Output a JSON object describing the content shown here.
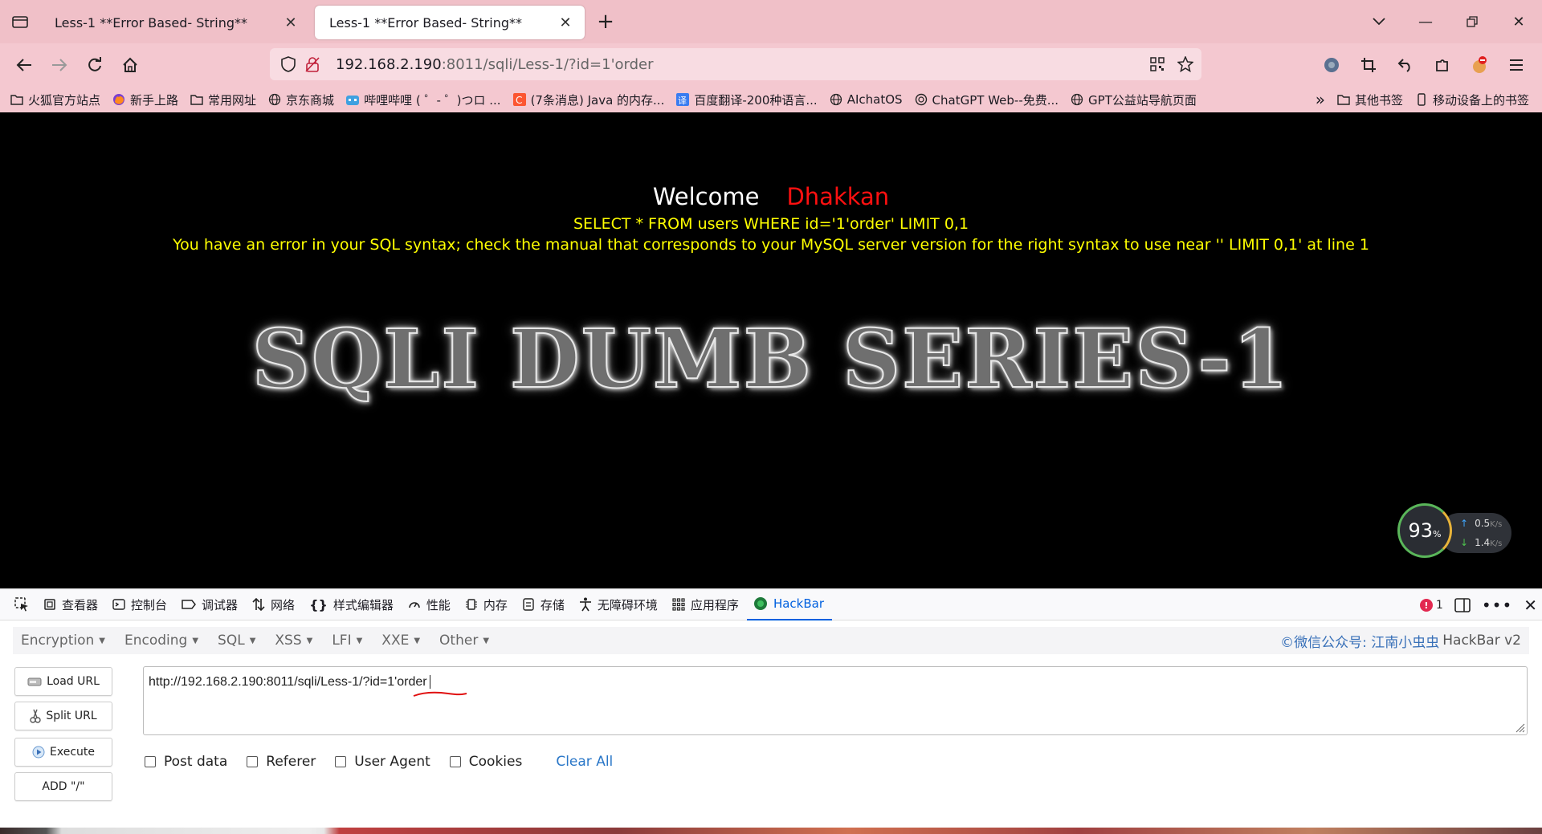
{
  "browser": {
    "tabs": [
      {
        "title": "Less-1 **Error Based- String**",
        "active": false
      },
      {
        "title": "Less-1 **Error Based- String**",
        "active": true
      }
    ],
    "url": {
      "host": "192.168.2.190",
      "rest": ":8011/sqli/Less-1/?id=1'order"
    },
    "bookmarks": [
      {
        "label": "火狐官方站点",
        "icon": "folder-icon"
      },
      {
        "label": "新手上路",
        "icon": "firefox-icon"
      },
      {
        "label": "常用网址",
        "icon": "folder-icon"
      },
      {
        "label": "京东商城",
        "icon": "globe-icon"
      },
      {
        "label": "哔哩哔哩 ( ゜- ゜)つロ ...",
        "icon": "bilibili-icon"
      },
      {
        "label": "(7条消息) Java 的内存...",
        "icon": "csdn-icon"
      },
      {
        "label": "百度翻译-200种语言...",
        "icon": "baidu-translate-icon"
      },
      {
        "label": "AIchatOS",
        "icon": "globe-icon"
      },
      {
        "label": "ChatGPT Web--免费...",
        "icon": "openai-icon"
      },
      {
        "label": "GPT公益站导航页面",
        "icon": "globe-icon"
      }
    ],
    "bookmarks_right": [
      "其他书签",
      "移动设备上的书签"
    ]
  },
  "page": {
    "welcome": "Welcome",
    "name": "Dhakkan",
    "sql": "SELECT * FROM users WHERE id='1'order' LIMIT 0,1",
    "error": "You have an error in your SQL syntax; check the manual that corresponds to your MySQL server version for the right syntax to use near '' LIMIT 0,1' at line 1",
    "title": "SQLI DUMB SERIES-1"
  },
  "speed": {
    "percent": "93",
    "unit": "%",
    "up": "0.5",
    "down": "1.4",
    "rate_unit": "K/s"
  },
  "devtools": {
    "tabs": [
      {
        "label": "查看器",
        "icon": "inspector-icon"
      },
      {
        "label": "控制台",
        "icon": "console-icon"
      },
      {
        "label": "调试器",
        "icon": "debugger-icon"
      },
      {
        "label": "网络",
        "icon": "network-icon"
      },
      {
        "label": "样式编辑器",
        "icon": "style-editor-icon"
      },
      {
        "label": "性能",
        "icon": "performance-icon"
      },
      {
        "label": "内存",
        "icon": "memory-icon"
      },
      {
        "label": "存储",
        "icon": "storage-icon"
      },
      {
        "label": "无障碍环境",
        "icon": "accessibility-icon"
      },
      {
        "label": "应用程序",
        "icon": "application-icon"
      },
      {
        "label": "HackBar",
        "icon": "hackbar-icon"
      }
    ],
    "error_count": "1"
  },
  "hackbar": {
    "menu": [
      "Encryption",
      "Encoding",
      "SQL",
      "XSS",
      "LFI",
      "XXE",
      "Other"
    ],
    "brand_link": "©微信公众号: 江南小虫虫",
    "brand_name": "HackBar v2",
    "buttons": {
      "load": "Load URL",
      "split": "Split URL",
      "execute": "Execute",
      "add": "ADD \"/\""
    },
    "url_value": "http://192.168.2.190:8011/sqli/Less-1/?id=1'order",
    "options": [
      "Post data",
      "Referer",
      "User Agent",
      "Cookies"
    ],
    "clear": "Clear All"
  },
  "colors": {
    "tabbar": "#f0c0c8",
    "page_bg": "#000000",
    "sql_text": "#ffff00",
    "name_text": "#ff1010",
    "hackbar_accent": "#0060df"
  }
}
